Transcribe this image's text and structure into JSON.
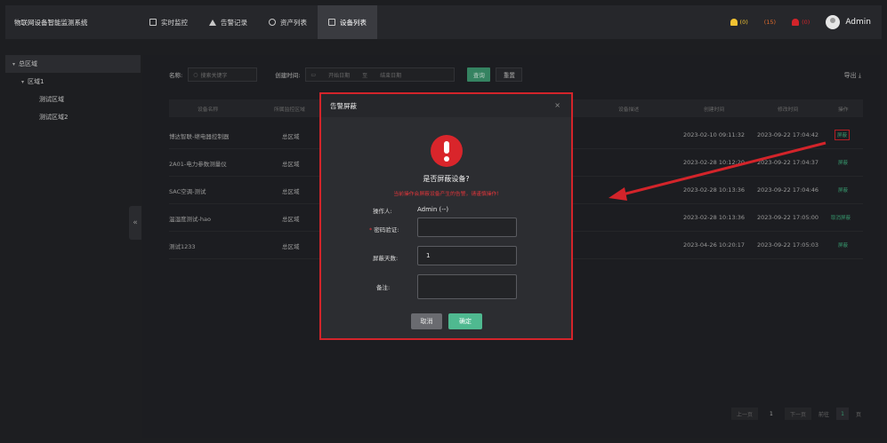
{
  "header": {
    "app_title": "物联网设备智能监测系统",
    "nav": [
      {
        "label": "实时监控",
        "icon": "monitor-icon",
        "active": false
      },
      {
        "label": "告警记录",
        "icon": "warning-icon",
        "active": false
      },
      {
        "label": "资产列表",
        "icon": "layers-icon",
        "active": false
      },
      {
        "label": "设备列表",
        "icon": "list-icon",
        "active": true
      }
    ],
    "alarms": [
      {
        "count": "(0)",
        "color": "#f1c232",
        "icon": "bell-icon"
      },
      {
        "count": "(15)",
        "color": "#e06a2b",
        "icon": "bell-icon"
      },
      {
        "count": "(0)",
        "color": "#d3242a",
        "icon": "bell-icon"
      }
    ],
    "user_name": "Admin"
  },
  "sidebar": {
    "root": "总区域",
    "child": "区域1",
    "leaves": [
      "测试区域",
      "测试区域2"
    ],
    "collapse_label": "«"
  },
  "filters": {
    "name_label": "名称:",
    "name_placeholder": "搜索关键字",
    "created_label": "创建时间:",
    "start_placeholder": "开始日期",
    "range_sep": "至",
    "end_placeholder": "结束日期",
    "query_label": "查询",
    "reset_label": "重置",
    "export_label": "导出"
  },
  "table": {
    "headers": [
      "设备名称",
      "所属监控区域",
      "设备描述",
      "创建时间",
      "修改时间",
      "操作"
    ],
    "rows": [
      {
        "name": "博达智联-继电器控制器",
        "area": "总区域",
        "created": "2023-02-10 09:11:32",
        "modified": "2023-09-22 17:04:42",
        "op": "屏蔽"
      },
      {
        "name": "2A01-电力参数测量仪",
        "area": "总区域",
        "created": "2023-02-28 10:12:20",
        "modified": "2023-09-22 17:04:37",
        "op": "屏蔽"
      },
      {
        "name": "SAC空调-测试",
        "area": "总区域",
        "created": "2023-02-28 10:13:36",
        "modified": "2023-09-22 17:04:46",
        "op": "屏蔽"
      },
      {
        "name": "温湿度测试-hao",
        "area": "总区域",
        "created": "2023-02-28 10:13:36",
        "modified": "2023-09-22 17:05:00",
        "op": "取消屏蔽"
      },
      {
        "name": "测试1233",
        "area": "总区域",
        "created": "2023-04-26 10:20:17",
        "modified": "2023-09-22 17:05:03",
        "op": "屏蔽"
      }
    ]
  },
  "pagination": {
    "prev": "上一页",
    "current": "1",
    "next": "下一页",
    "goto_label": "前往",
    "goto_value": "1",
    "page_unit": "页"
  },
  "modal": {
    "title": "告警屏蔽",
    "close": "×",
    "question": "是否屏蔽设备?",
    "warning": "当前操作会屏蔽设备产生的告警，请谨慎操作!",
    "operator_label": "操作人:",
    "operator_value": "Admin  (--)",
    "password_label": "密码验证:",
    "password_value": "",
    "days_label": "屏蔽天数:",
    "days_value": "1",
    "remark_label": "备注:",
    "remark_value": "",
    "cancel_label": "取消",
    "ok_label": "确定"
  },
  "colors": {
    "accent_green": "#3fae7e",
    "highlight_red": "#d3242a"
  }
}
